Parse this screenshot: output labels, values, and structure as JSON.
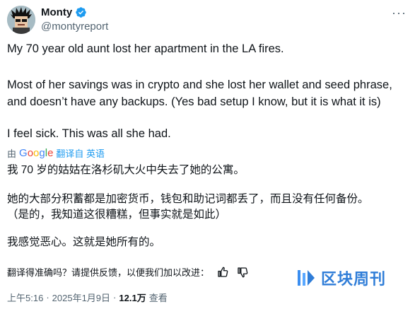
{
  "author": {
    "name": "Monty",
    "handle": "@montyreport",
    "more_label": "···"
  },
  "tweet": {
    "paragraph_1": "My 70 year old aunt lost her apartment in the LA fires.",
    "paragraph_2_line_1": "Most of her savings was in crypto and she lost her wallet and seed phrase,",
    "paragraph_2_line_2": "and doesn’t have any backups. (Yes bad setup I know, but it is what it is)",
    "paragraph_3": "I feel sick. This was all she had."
  },
  "translation": {
    "by_label": "由",
    "google_label": "Google",
    "translated_from_label": "翻译自 英语",
    "line_1": "我 70 岁的姑姑在洛杉矶大火中失去了她的公寓。",
    "line_2": "她的大部分积蓄都是加密货币，钱包和助记词都丢了，而且没有任何备份。",
    "line_3": "（是的，我知道这很糟糕，但事实就是如此）",
    "line_4": "我感觉恶心。这就是她所有的。"
  },
  "feedback": {
    "question": "翻译得准确吗？请提供反馈，以便我们加以改进："
  },
  "meta": {
    "time": "上午5:16",
    "separator": "·",
    "date": "2025年1月9日",
    "views_count": "12.1万",
    "views_label": "查看"
  },
  "watermark": {
    "text": "区块周刊"
  },
  "colors": {
    "verified_blue": "#1d9bf0",
    "link_blue": "#1d9bf0",
    "secondary_text": "#536471",
    "watermark_blue": "#2f7dd8"
  }
}
